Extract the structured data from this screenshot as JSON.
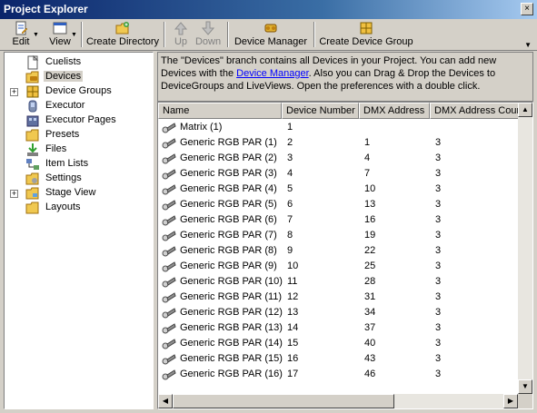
{
  "window": {
    "title": "Project Explorer",
    "close_glyph": "×"
  },
  "toolbar": {
    "edit": "Edit",
    "view": "View",
    "create_directory": "Create Directory",
    "up": "Up",
    "down": "Down",
    "device_manager": "Device Manager",
    "create_device_group": "Create Device Group"
  },
  "tree": {
    "items": [
      {
        "label": "Cuelists",
        "icon": "document-icon",
        "expandable": false
      },
      {
        "label": "Devices",
        "icon": "devices-folder-icon",
        "expandable": false,
        "selected": true
      },
      {
        "label": "Device Groups",
        "icon": "device-groups-icon",
        "expandable": true
      },
      {
        "label": "Executor",
        "icon": "executor-icon",
        "expandable": false
      },
      {
        "label": "Executor Pages",
        "icon": "executor-pages-icon",
        "expandable": false
      },
      {
        "label": "Presets",
        "icon": "presets-icon",
        "expandable": false
      },
      {
        "label": "Files",
        "icon": "files-icon",
        "expandable": false
      },
      {
        "label": "Item Lists",
        "icon": "item-lists-icon",
        "expandable": false
      },
      {
        "label": "Settings",
        "icon": "settings-folder-icon",
        "expandable": false
      },
      {
        "label": "Stage View",
        "icon": "stage-view-folder-icon",
        "expandable": true
      },
      {
        "label": "Layouts",
        "icon": "layouts-folder-icon",
        "expandable": false
      }
    ]
  },
  "info": {
    "text_before": "The \"Devices\" branch contains all Devices in your Project. You can add new Devices with the ",
    "link": "Device Manager",
    "text_after": ". Also you can Drag & Drop the Devices to DeviceGroups and LiveViews. Open the preferences with a double click."
  },
  "grid": {
    "columns": [
      "Name",
      "Device Number",
      "DMX Address",
      "DMX Address Count"
    ],
    "rows": [
      [
        "Matrix (1)",
        "1",
        "",
        ""
      ],
      [
        "Generic RGB PAR (1)",
        "2",
        "1",
        "3"
      ],
      [
        "Generic RGB PAR (2)",
        "3",
        "4",
        "3"
      ],
      [
        "Generic RGB PAR (3)",
        "4",
        "7",
        "3"
      ],
      [
        "Generic RGB PAR (4)",
        "5",
        "10",
        "3"
      ],
      [
        "Generic RGB PAR (5)",
        "6",
        "13",
        "3"
      ],
      [
        "Generic RGB PAR (6)",
        "7",
        "16",
        "3"
      ],
      [
        "Generic RGB PAR (7)",
        "8",
        "19",
        "3"
      ],
      [
        "Generic RGB PAR (8)",
        "9",
        "22",
        "3"
      ],
      [
        "Generic RGB PAR (9)",
        "10",
        "25",
        "3"
      ],
      [
        "Generic RGB PAR (10)",
        "11",
        "28",
        "3"
      ],
      [
        "Generic RGB PAR (11)",
        "12",
        "31",
        "3"
      ],
      [
        "Generic RGB PAR (12)",
        "13",
        "34",
        "3"
      ],
      [
        "Generic RGB PAR (13)",
        "14",
        "37",
        "3"
      ],
      [
        "Generic RGB PAR (14)",
        "15",
        "40",
        "3"
      ],
      [
        "Generic RGB PAR (15)",
        "16",
        "43",
        "3"
      ],
      [
        "Generic RGB PAR (16)",
        "17",
        "46",
        "3"
      ]
    ]
  },
  "colors": {
    "titlebar": "#0a246a",
    "face": "#d4d0c8",
    "link": "#0000ff"
  }
}
